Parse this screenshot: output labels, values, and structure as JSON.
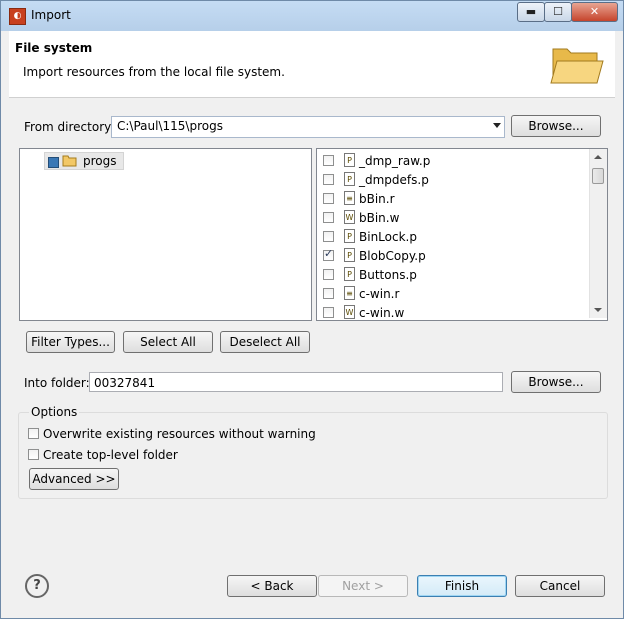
{
  "window": {
    "title": "Import",
    "icon": "eclipse-icon",
    "controls": {
      "minimize": "▬",
      "maximize": "☐",
      "close": "✕"
    }
  },
  "header": {
    "title": "File system",
    "description": "Import resources from the local file system."
  },
  "from_directory": {
    "label": "From directory:",
    "value": "C:\\Paul\\115\\progs",
    "browse": "Browse..."
  },
  "tree": {
    "items": [
      {
        "label": "progs",
        "checked": "partial"
      }
    ]
  },
  "files": [
    {
      "name": "_dmp_raw.p",
      "type": "P",
      "checked": false
    },
    {
      "name": "_dmpdefs.p",
      "type": "P",
      "checked": false
    },
    {
      "name": "bBin.r",
      "type": "≡",
      "checked": false
    },
    {
      "name": "bBin.w",
      "type": "W",
      "checked": false
    },
    {
      "name": "BinLock.p",
      "type": "P",
      "checked": false
    },
    {
      "name": "BlobCopy.p",
      "type": "P",
      "checked": true
    },
    {
      "name": "Buttons.p",
      "type": "P",
      "checked": false
    },
    {
      "name": "c-win.r",
      "type": "≡",
      "checked": false
    },
    {
      "name": "c-win.w",
      "type": "W",
      "checked": false
    }
  ],
  "selection_buttons": {
    "filter": "Filter Types...",
    "select_all": "Select All",
    "deselect_all": "Deselect All"
  },
  "into_folder": {
    "label": "Into folder:",
    "value": "00327841",
    "browse": "Browse..."
  },
  "options": {
    "title": "Options",
    "overwrite": "Overwrite existing resources without warning",
    "create_top": "Create top-level folder",
    "advanced": "Advanced >>"
  },
  "footer": {
    "help": "?",
    "back": "< Back",
    "next": "Next >",
    "finish": "Finish",
    "cancel": "Cancel"
  }
}
